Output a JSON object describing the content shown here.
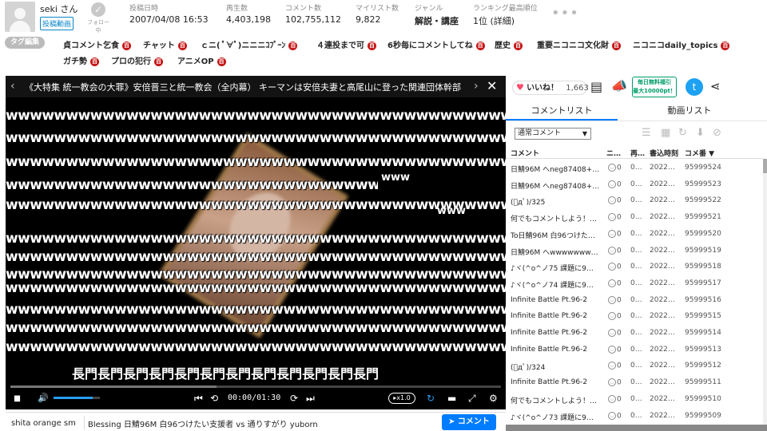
{
  "info": {
    "user_name": "seki さん",
    "poster_badge": "投稿動画",
    "follow_label": "フォロー中",
    "stats": [
      {
        "label": "投稿日時",
        "value": "2007/04/08 16:53"
      },
      {
        "label": "再生数",
        "value": "4,403,198"
      },
      {
        "label": "コメント数",
        "value": "102,755,112"
      },
      {
        "label": "マイリスト数",
        "value": "9,822"
      },
      {
        "label": "ジャンル",
        "value": "解説・講座"
      },
      {
        "label": "ランキング最高順位",
        "value": "1位 (詳細)"
      }
    ]
  },
  "tags": {
    "edit_label": "タグ編集",
    "items": [
      {
        "label": "貞コメント乞食"
      },
      {
        "label": "チャット"
      },
      {
        "label": "ｃニ( ﾟ∀ﾟ)ニニニｺﾌﾟｰﾝ"
      },
      {
        "label": "４連投まで可"
      },
      {
        "label": "6秒毎にコメントしてね"
      },
      {
        "label": "歴史"
      },
      {
        "label": "重要ニコニコ文化財"
      },
      {
        "label": "ニコニコdaily_topics"
      },
      {
        "label": "ガチ勢"
      },
      {
        "label": "プロの犯行"
      },
      {
        "label": "アニメOP"
      }
    ],
    "dic_symbol": "百"
  },
  "player": {
    "title": "《大特集 統一教会の大罪》安倍晋三と統一教会（全内幕） キーマンは安倍夫妻と高尾山に登った関連団体幹部",
    "title_prev": "‹",
    "title_next": "›",
    "close_symbol": "✕",
    "ww_text": "wwwwwwwwwwwwwwwwwwwwwwwwwwwwwwwwwwwwwwwwwwwwwwwwwwwwwwwwwwwwwwwwwwwwwwwwwwwwwwwwwwwwwwwwwwwwwww",
    "ww_small_1": "www",
    "ww_small_2": "www",
    "subtitle": "長門長門長門長門長門長門長門長門長門長門長門長門",
    "time": "00:00/01:30",
    "speed": "▸x1.0",
    "seek_buffer": 0.42,
    "volume": 0.85,
    "icons": {
      "pause": "▮▮",
      "volume": "🔊",
      "skip_back": "⏮",
      "rewind10": "⟲",
      "forward10": "⟳",
      "skip_next": "⏭",
      "loop": "↻",
      "comment_toggle": "▬",
      "fullscreen": "⤢",
      "settings": "⚙"
    }
  },
  "comment_bar": {
    "command_value": "shita orange sm",
    "comment_value": "Blessing 日鯖96M 白96つけたい支援者 vs 通りすがり yuborn",
    "submit_label": "➤ コメント"
  },
  "rpanel": {
    "like_label": "いいね！",
    "like_count": "1,663",
    "ad_line1": "毎日無料福引",
    "ad_line2": "最大10000pt！",
    "tab_comments": "コメントリスト",
    "tab_videos": "動画リスト",
    "comment_type": "通常コメント",
    "columns": {
      "comment": "コメント",
      "nico": "ニ…",
      "play": "再…",
      "date": "書込時刻",
      "no": "コメ番 ▼"
    },
    "comments": [
      {
        "text": "日鯖96M へneg87408+…",
        "nico": "0",
        "play": "0…",
        "date": "2022…",
        "no": "95999524"
      },
      {
        "text": "日鯖96M へneg87408+…",
        "nico": "0",
        "play": "0…",
        "date": "2022…",
        "no": "95999523"
      },
      {
        "text": "(ﾟдﾟ)/325",
        "nico": "0",
        "play": "0…",
        "date": "2022…",
        "no": "95999522"
      },
      {
        "text": "何でもコメントしよう！…",
        "nico": "0",
        "play": "0…",
        "date": "2022…",
        "no": "95999521"
      },
      {
        "text": "To日鯖96M 白96つけた…",
        "nico": "0",
        "play": "0…",
        "date": "2022…",
        "no": "95999520"
      },
      {
        "text": "日鯖96M へwwwwwww…",
        "nico": "0",
        "play": "0…",
        "date": "2022…",
        "no": "95999519"
      },
      {
        "text": "♪ヾ(^o^ノ75 課題に9…",
        "nico": "0",
        "play": "0…",
        "date": "2022…",
        "no": "95999518"
      },
      {
        "text": "♪ヾ(^o^ノ74 課題に9…",
        "nico": "0",
        "play": "0…",
        "date": "2022…",
        "no": "95999517"
      },
      {
        "text": "Infinite Battle Pt.96-2",
        "nico": "0",
        "play": "0…",
        "date": "2022…",
        "no": "95999516"
      },
      {
        "text": "Infinite Battle Pt.96-2",
        "nico": "0",
        "play": "0…",
        "date": "2022…",
        "no": "95999515"
      },
      {
        "text": "Infinite Battle Pt.96-2",
        "nico": "0",
        "play": "0…",
        "date": "2022…",
        "no": "95999514"
      },
      {
        "text": "Infinite Battle Pt.96-2",
        "nico": "0",
        "play": "0…",
        "date": "2022…",
        "no": "95999513"
      },
      {
        "text": "(ﾟдﾟ)/324",
        "nico": "0",
        "play": "0…",
        "date": "2022…",
        "no": "95999512"
      },
      {
        "text": "Infinite Battle Pt.96-2",
        "nico": "0",
        "play": "0…",
        "date": "2022…",
        "no": "95999511"
      },
      {
        "text": "何でもコメントしよう！…",
        "nico": "0",
        "play": "0…",
        "date": "2022…",
        "no": "95999510"
      },
      {
        "text": "♪ヾ(^o^ノ73 課題に9…",
        "nico": "0",
        "play": "0…",
        "date": "2022…",
        "no": "95999509"
      }
    ]
  },
  "colors": {
    "accent": "#007cff",
    "dic_red": "#c51717",
    "twitter": "#1da1f2",
    "like_heart": "#ff4b6c"
  }
}
